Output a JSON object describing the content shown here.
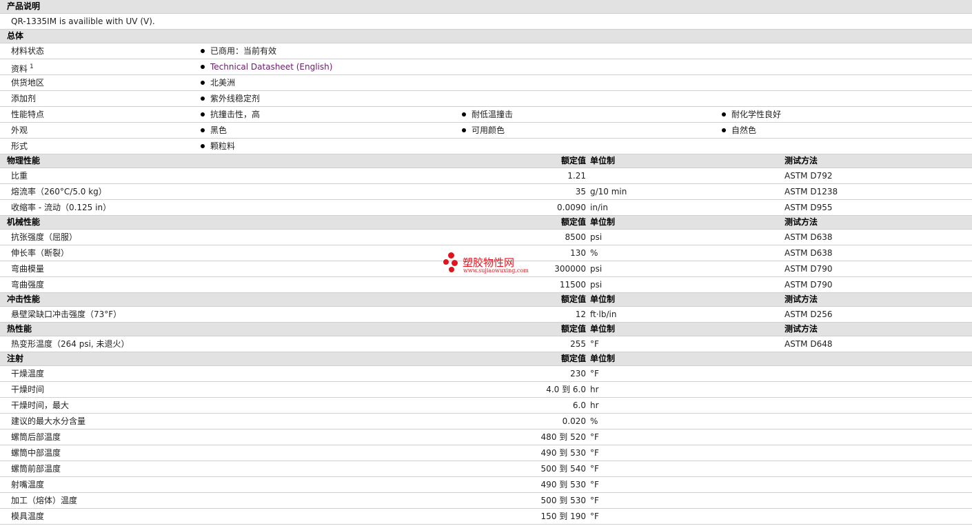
{
  "description": {
    "header": "产品说明",
    "text": "QR-1335IM is availible with UV (V)."
  },
  "general": {
    "header": "总体",
    "rows": [
      {
        "label": "材料状态",
        "items": [
          "已商用：当前有效"
        ]
      },
      {
        "label": "资料",
        "sup": "1",
        "items": [
          "Technical Datasheet (English)"
        ],
        "link": true
      },
      {
        "label": "供货地区",
        "items": [
          "北美洲"
        ]
      },
      {
        "label": "添加剂",
        "items": [
          "紫外线稳定剂"
        ]
      },
      {
        "label": "性能特点",
        "items": [
          "抗撞击性，高",
          "耐低温撞击",
          "耐化学性良好"
        ]
      },
      {
        "label": "外观",
        "items": [
          "黑色",
          "可用颜色",
          "自然色"
        ]
      },
      {
        "label": "形式",
        "items": [
          "颗粒料"
        ]
      }
    ]
  },
  "columns": {
    "value": "额定值",
    "unit": "单位制",
    "test": "测试方法"
  },
  "sections": [
    {
      "header": "物理性能",
      "has_test": true,
      "rows": [
        {
          "label": "比重",
          "value": "1.21",
          "unit": "",
          "test": "ASTM D792"
        },
        {
          "label": "熔流率（260°C/5.0 kg）",
          "value": "35",
          "unit": "g/10 min",
          "test": "ASTM D1238"
        },
        {
          "label": "收缩率 - 流动（0.125 in）",
          "value": "0.0090",
          "unit": "in/in",
          "test": "ASTM D955"
        }
      ]
    },
    {
      "header": "机械性能",
      "has_test": true,
      "rows": [
        {
          "label": "抗张强度（屈服）",
          "value": "8500",
          "unit": "psi",
          "test": "ASTM D638"
        },
        {
          "label": "伸长率（断裂）",
          "value": "130",
          "unit": "%",
          "test": "ASTM D638"
        },
        {
          "label": "弯曲模量",
          "value": "300000",
          "unit": "psi",
          "test": "ASTM D790"
        },
        {
          "label": "弯曲强度",
          "value": "11500",
          "unit": "psi",
          "test": "ASTM D790"
        }
      ]
    },
    {
      "header": "冲击性能",
      "has_test": true,
      "rows": [
        {
          "label": "悬壁梁缺口冲击强度（73°F）",
          "value": "12",
          "unit": "ft·lb/in",
          "test": "ASTM D256"
        }
      ]
    },
    {
      "header": "热性能",
      "has_test": true,
      "rows": [
        {
          "label": "热变形温度（264 psi, 未退火）",
          "value": "255",
          "unit": "°F",
          "test": "ASTM D648"
        }
      ]
    },
    {
      "header": "注射",
      "has_test": false,
      "rows": [
        {
          "label": "干燥温度",
          "value": "230",
          "unit": "°F",
          "test": ""
        },
        {
          "label": "干燥时间",
          "value": "4.0 到  6.0",
          "unit": "hr",
          "test": ""
        },
        {
          "label": "干燥时间，最大",
          "value": "6.0",
          "unit": "hr",
          "test": ""
        },
        {
          "label": "建议的最大水分含量",
          "value": "0.020",
          "unit": "%",
          "test": ""
        },
        {
          "label": "螺筒后部温度",
          "value": "480 到  520",
          "unit": "°F",
          "test": ""
        },
        {
          "label": "螺筒中部温度",
          "value": "490 到  530",
          "unit": "°F",
          "test": ""
        },
        {
          "label": "螺筒前部温度",
          "value": "500 到  540",
          "unit": "°F",
          "test": ""
        },
        {
          "label": "射嘴温度",
          "value": "490 到  530",
          "unit": "°F",
          "test": ""
        },
        {
          "label": "加工（熔体）温度",
          "value": "500 到  530",
          "unit": "°F",
          "test": ""
        },
        {
          "label": "模具温度",
          "value": "150 到  190",
          "unit": "°F",
          "test": ""
        }
      ]
    }
  ],
  "watermark": {
    "title": "塑胶物性网",
    "subtitle": "www.sujiaowuxing.com",
    "color": "#e0141e"
  }
}
